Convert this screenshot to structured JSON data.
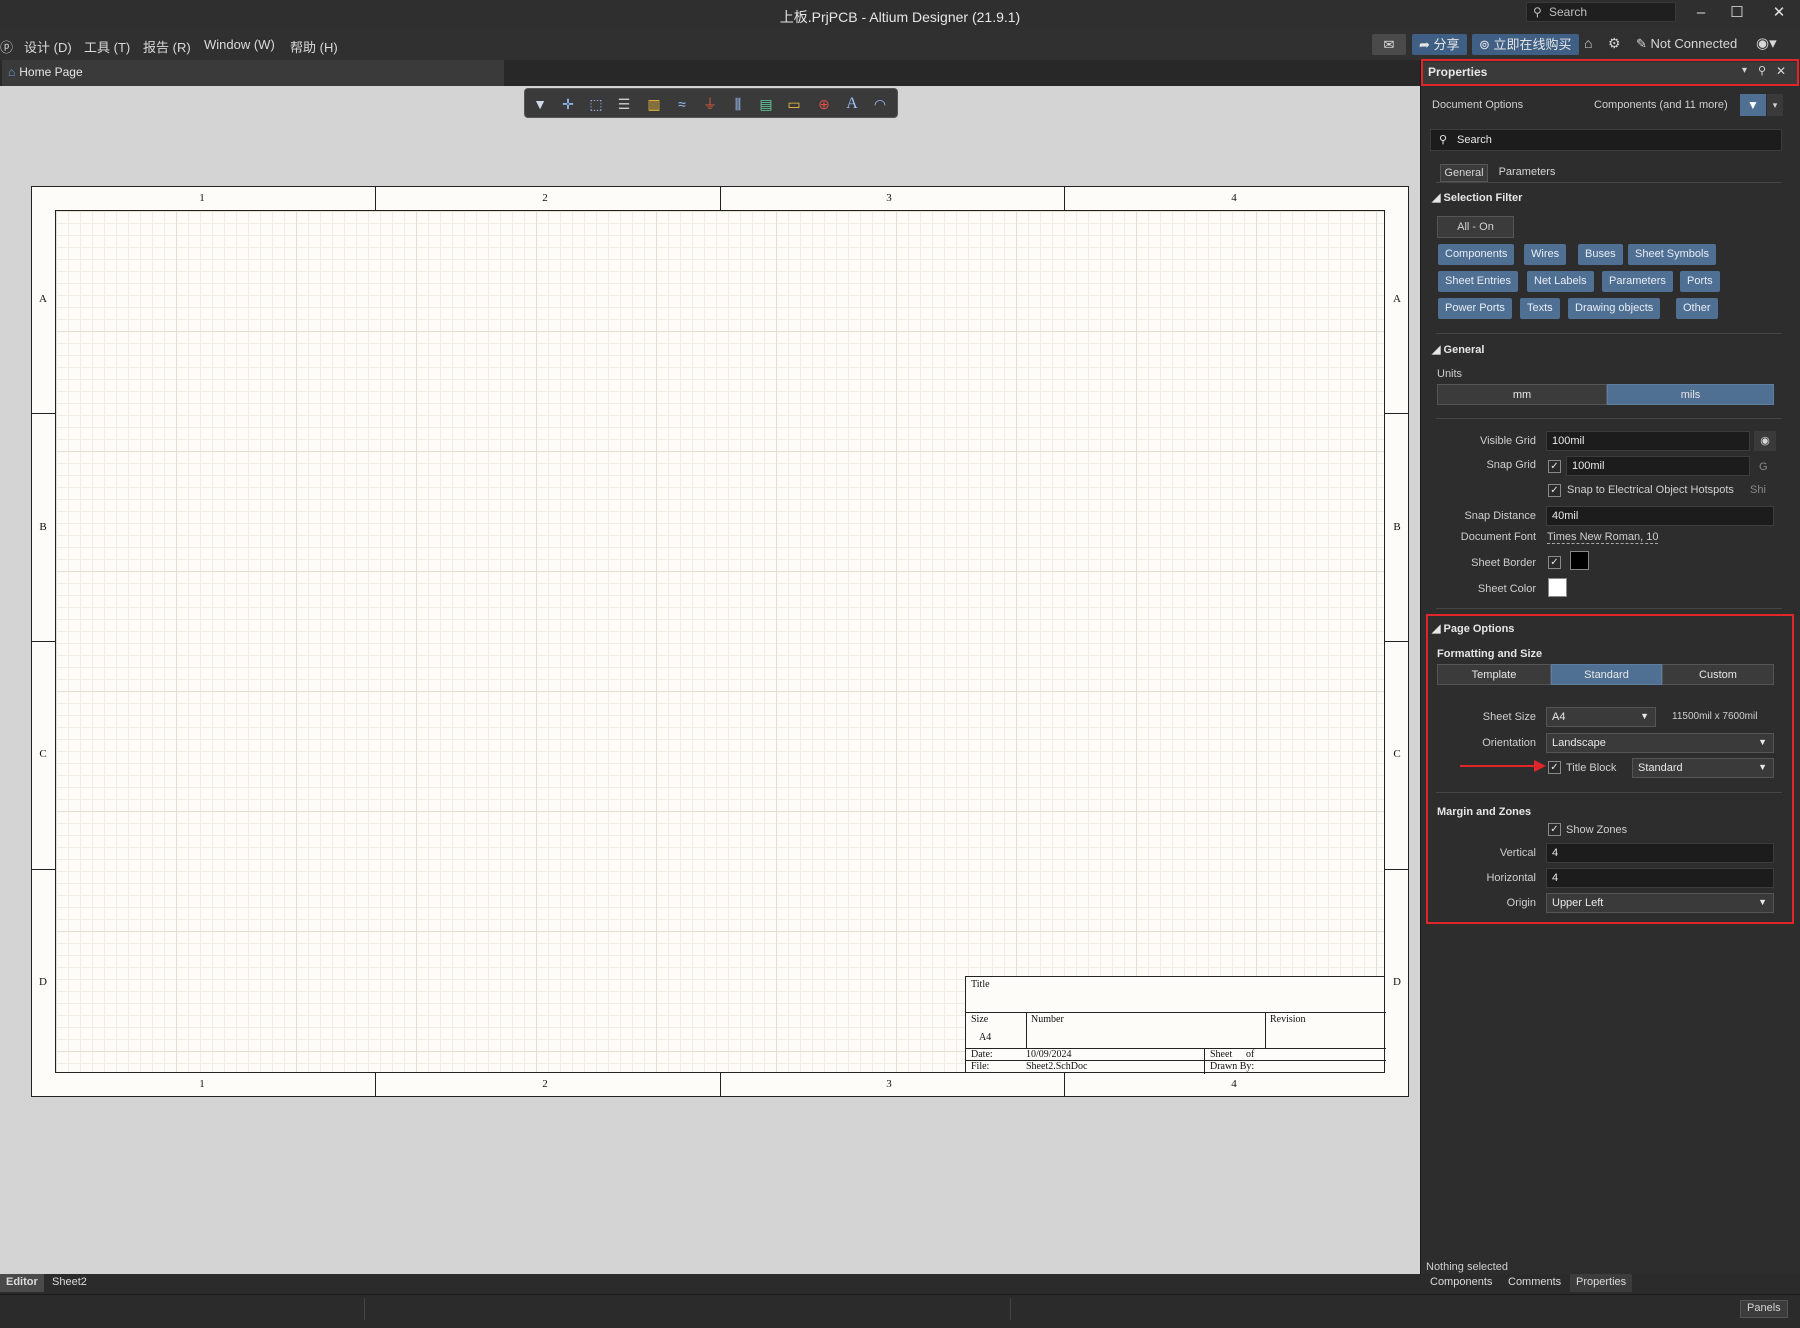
{
  "window": {
    "title": "上板.PrjPCB - Altium Designer (21.9.1)",
    "search_placeholder": "Search",
    "minimize": "‒",
    "maximize": "☐",
    "close": "✕"
  },
  "menu": {
    "first_fragment": "ⓟ",
    "items": [
      {
        "label": "设计 (D)"
      },
      {
        "label": "工具 (T)"
      },
      {
        "label": "报告 (R)"
      },
      {
        "label": "Window (W)"
      },
      {
        "label": "帮助 (H)"
      }
    ]
  },
  "toolbar_right": {
    "share": "➦ 分享",
    "buy": "⊚ 立即在线购买",
    "connection": "Not Connected"
  },
  "tabs": {
    "home": "Home Page"
  },
  "sheet": {
    "col_labels": [
      "1",
      "2",
      "3",
      "4"
    ],
    "row_labels": [
      "A",
      "B",
      "C",
      "D"
    ],
    "title_block": {
      "title": "Title",
      "size": "Size",
      "size_value": "A4",
      "number": "Number",
      "revision": "Revision",
      "date_label": "Date:",
      "date_value": "10/09/2024",
      "sheet_label": "Sheet",
      "of_label": "of",
      "file_label": "File:",
      "file_value": "Sheet2.SchDoc",
      "drawn_by": "Drawn By:"
    }
  },
  "panel": {
    "title": "Properties",
    "doc_options": "Document Options",
    "filter_summary": "Components (and 11 more)",
    "search_placeholder": "Search",
    "tab_general": "General",
    "tab_parameters": "Parameters",
    "selection_filter": {
      "heading": "Selection Filter",
      "all_on": "All - On",
      "chips_row1": [
        "Components",
        "Wires",
        "Buses",
        "Sheet Symbols"
      ],
      "chips_row2": [
        "Sheet Entries",
        "Net Labels",
        "Parameters",
        "Ports"
      ],
      "chips_row3": [
        "Power Ports",
        "Texts",
        "Drawing objects",
        "Other"
      ]
    },
    "general": {
      "heading": "General",
      "units_label": "Units",
      "unit_mm": "mm",
      "unit_mils": "mils",
      "visible_grid_label": "Visible Grid",
      "visible_grid_value": "100mil",
      "snap_grid_label": "Snap Grid",
      "snap_grid_value": "100mil",
      "snap_grid_key": "G",
      "snap_hotspots": "Snap to Electrical Object Hotspots",
      "snap_hotspots_key": "Shi",
      "snap_distance_label": "Snap Distance",
      "snap_distance_value": "40mil",
      "doc_font_label": "Document Font",
      "doc_font_value": "Times New Roman, 10",
      "sheet_border_label": "Sheet Border",
      "sheet_color_label": "Sheet Color"
    },
    "page_options": {
      "heading": "Page Options",
      "fmt_heading": "Formatting and Size",
      "seg_template": "Template",
      "seg_standard": "Standard",
      "seg_custom": "Custom",
      "sheet_size_label": "Sheet Size",
      "sheet_size_value": "A4",
      "sheet_dims": "11500mil x 7600mil",
      "orientation_label": "Orientation",
      "orientation_value": "Landscape",
      "title_block_label": "Title Block",
      "title_block_value": "Standard",
      "margin_heading": "Margin and Zones",
      "show_zones": "Show Zones",
      "vertical_label": "Vertical",
      "vertical_value": "4",
      "horizontal_label": "Horizontal",
      "horizontal_value": "4",
      "origin_label": "Origin",
      "origin_value": "Upper Left"
    },
    "nothing_selected": "Nothing selected",
    "bottom_tabs": [
      "Components",
      "Comments",
      "Properties"
    ]
  },
  "bottom": {
    "editor_tab": "Editor",
    "sheet_tab": "Sheet2",
    "panels_btn": "Panels"
  },
  "colors": {
    "accent": "#4f6f93",
    "highlight_red": "#e0262a",
    "canvas": "#d4d4d4",
    "sheet": "#fdfcf8"
  }
}
